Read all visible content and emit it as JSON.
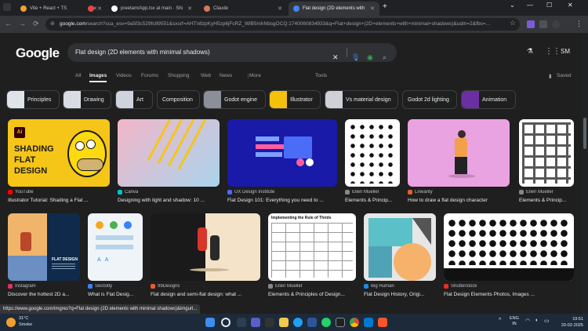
{
  "browser": {
    "tabs": [
      {
        "label": "Vite + React + TS",
        "active": false,
        "color": "#f0a030"
      },
      {
        "label": "",
        "active": false,
        "color": "#e8453c"
      },
      {
        "label": "preetam/App.tsx at main · Shi",
        "active": false,
        "color": "#ffffff"
      },
      {
        "label": "Claude",
        "active": false,
        "color": "#d97757"
      },
      {
        "label": "Flat design (2D elements with",
        "active": true,
        "color": "#4285f4"
      }
    ],
    "new_tab": "+",
    "url_host": "google.com",
    "url_rest": "/search?sca_esv=9a5f3c529fc89551&sxsrf=AHTn8zpKyH5zp6jFcRZ_WlB5mhNbsgOCQ:1740060834933&q=Flat+design+(2D+elements+with+minimal+shadows)&udm=2&fbs=..."
  },
  "google": {
    "logo": "Google",
    "query": "Flat design (2D elements with minimal shadows)",
    "avatar_initials": "SM",
    "nav_tabs": [
      "All",
      "Images",
      "Videos",
      "Forums",
      "Shopping",
      "Web",
      "News",
      "More",
      "Tools"
    ],
    "saved_label": "Saved",
    "chips": [
      {
        "label": "Principles",
        "thumb": "#dfe3ea"
      },
      {
        "label": "Drawing",
        "thumb": "#d9dde3"
      },
      {
        "label": "Art",
        "thumb": "#cfd4dc"
      },
      {
        "label": "Composition",
        "thumb": ""
      },
      {
        "label": "Godot engine",
        "thumb": "#8a8f98"
      },
      {
        "label": "Illustrator",
        "thumb": "#f4c20d"
      },
      {
        "label": "Vs material design",
        "thumb": "#d0d0d8"
      },
      {
        "label": "Godot 2d lighting",
        "thumb": ""
      },
      {
        "label": "Animation",
        "thumb": "#6b2fa3"
      }
    ],
    "results_row1": [
      {
        "source": "YouTube",
        "title": "Illustrator Tutorial: Shading a Flat ...",
        "fav": "#ff0000"
      },
      {
        "source": "Canva",
        "title": "Designing with light and shadow: 10 ...",
        "fav": "#00c4cc"
      },
      {
        "source": "UX Design Institute",
        "title": "Flat Design 101: Everything you need to ...",
        "fav": "#4a6cf7"
      },
      {
        "source": "Ellen Mueller",
        "title": "Elements & Princip...",
        "fav": "#888888"
      },
      {
        "source": "Linearity",
        "title": "How to draw a flat design character",
        "fav": "#e85d2a"
      },
      {
        "source": "Ellen Mueller",
        "title": "Elements & Princip...",
        "fav": "#888888"
      }
    ],
    "results_row2": [
      {
        "source": "Instagram",
        "title": "Discover the hottest 2D a...",
        "fav": "#e1306c"
      },
      {
        "source": "SeoSitly",
        "title": "What is Flat Desig...",
        "fav": "#3b82f6"
      },
      {
        "source": "99Designs",
        "title": "Flat design and semi-flat design: what ...",
        "fav": "#e85d2a"
      },
      {
        "source": "Ellen Mueller",
        "title": "Elements & Principles of Design...",
        "fav": "#888888"
      },
      {
        "source": "Big Human",
        "title": "Flat Design History, Origi...",
        "fav": "#1e88e5"
      },
      {
        "source": "Shutterstock",
        "title": "Flat Design Elements Photos, Images ...",
        "fav": "#ee2b24"
      }
    ],
    "img_text": {
      "shading_line1": "SHADING",
      "shading_line2": "FLAT",
      "shading_line3": "DESIGN",
      "ai_badge": "Ai",
      "flat_design_small": "FLAT DESIGN",
      "rule_of_thirds": "Implementing the Rule of Thirds"
    }
  },
  "status_url": "https://www.google.com/imgres?q=Flat design (2D elements with minimal shadows)&imgurl...",
  "taskbar": {
    "weather_temp": "31°C",
    "weather_desc": "Smoke",
    "lang_top": "ENG",
    "lang_bottom": "IN",
    "time": "19:51",
    "date": "20-02-2025"
  },
  "colors": {
    "page_bg": "#1f1f1f",
    "search_bg": "#303134",
    "taskbar_bg": "#1c2a3a"
  }
}
